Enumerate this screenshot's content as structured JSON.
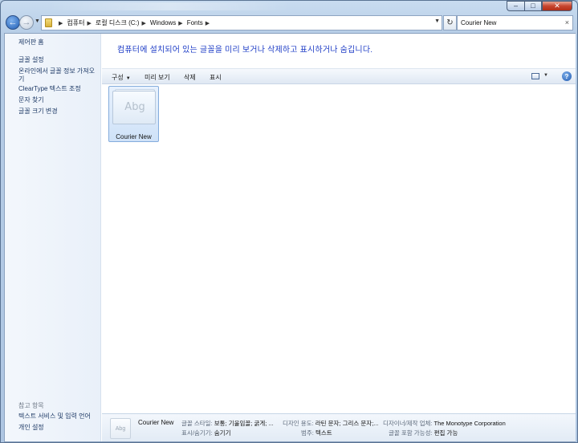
{
  "window": {
    "caption": {
      "minimize": "–",
      "maximize": "□",
      "close": "✕"
    }
  },
  "nav": {
    "back_glyph": "←",
    "forward_glyph": "→",
    "breadcrumbs": [
      "컴퓨터",
      "로컬 디스크 (C:)",
      "Windows",
      "Fonts"
    ],
    "refresh_glyph": "↻",
    "search_value": "Courier New",
    "clear_glyph": "×"
  },
  "sidebar": {
    "home": "제어판 홈",
    "links": [
      "글꼴 설정",
      "온라인에서 글꼴 정보 가져오기",
      "ClearType 텍스트 조정",
      "문자 찾기",
      "글꼴 크기 변경"
    ],
    "see_also_label": "참고 항목",
    "see_also": [
      "텍스트 서비스 및 입력 언어",
      "개인 설정"
    ]
  },
  "main": {
    "title": "컴퓨터에 설치되어 있는 글꼴을 미리 보거나 삭제하고 표시하거나 숨깁니다."
  },
  "commands": {
    "organize": "구성",
    "preview": "미리 보기",
    "delete": "삭제",
    "show": "표시",
    "help": "?"
  },
  "items": [
    {
      "name": "Courier New",
      "sample": "Abg"
    }
  ],
  "details": {
    "thumb_sample": "Abg",
    "name": "Courier New",
    "style_label": "글꼴 스타일:",
    "style_value": "보통; 기울임꼴; 굵게; ...",
    "show_label": "표시/숨기기:",
    "show_value": "숨기기",
    "design_label": "디자인 용도:",
    "design_value": "라틴 문자; 그리스 문자;...",
    "category_label": "범주:",
    "category_value": "텍스트",
    "designer_label": "디자이너/제작 업체:",
    "designer_value": "The Monotype Corporation",
    "embed_label": "글꼴 포함 가능성:",
    "embed_value": "편집 가능"
  }
}
